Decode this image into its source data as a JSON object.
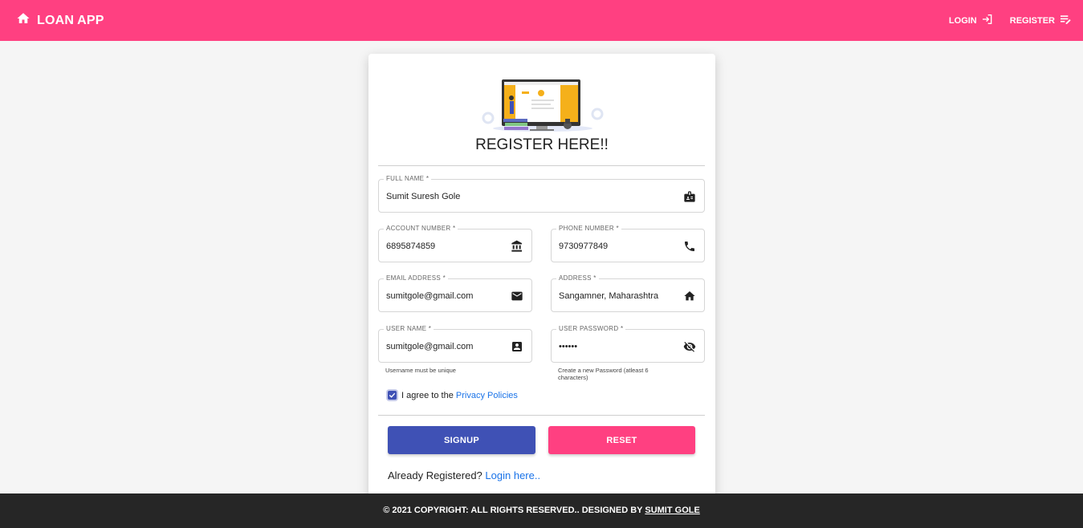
{
  "navbar": {
    "brand": "LOAN APP",
    "brand_icon": "home-icon",
    "login_label": "LOGIN",
    "login_icon": "login-icon",
    "register_label": "REGISTER",
    "register_icon": "register-icon",
    "bg_color": "#ff4081"
  },
  "form": {
    "illustration": "computer-illustration",
    "title": "REGISTER HERE!!",
    "full_name": {
      "label": "FULL NAME *",
      "value": "Sumit Suresh Gole",
      "icon": "id-badge-icon"
    },
    "account_number": {
      "label": "ACCOUNT NUMBER *",
      "value": "6895874859",
      "icon": "bank-icon"
    },
    "phone_number": {
      "label": "PHONE NUMBER *",
      "value": "9730977849",
      "icon": "phone-icon"
    },
    "email": {
      "label": "EMAIL ADDRESS *",
      "value": "sumitgole@gmail.com",
      "icon": "mail-icon"
    },
    "address": {
      "label": "ADDRESS *",
      "value": "Sangamner, Maharashtra",
      "icon": "home-icon"
    },
    "username": {
      "label": "USER NAME *",
      "value": "sumitgole@gmail.com",
      "icon": "account-box-icon",
      "helper": "Username must be unique"
    },
    "password": {
      "label": "USER PASSWORD *",
      "value": "••••••",
      "icon": "visibility-off-icon",
      "helper": "Create a new Password (atleast 6 characters)"
    },
    "agree_prefix": "I agree to the",
    "agree_link": "Privacy Policies",
    "agree_checked": true,
    "signup_label": "SIGNUP",
    "reset_label": "RESET",
    "already_text": "Already Registered?",
    "login_link": "Login here..",
    "primary_color": "#3f51b5",
    "secondary_color": "#ff4081"
  },
  "footer": {
    "text": "© 2021 COPYRIGHT: ALL RIGHTS RESERVED.. DESIGNED BY",
    "author": "SUMIT GOLE",
    "bg_color": "#262626"
  }
}
